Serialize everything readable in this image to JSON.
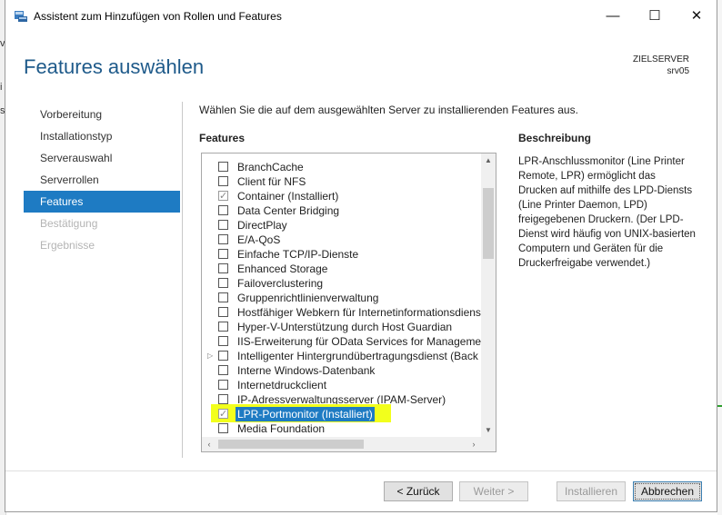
{
  "background_left": [
    "v",
    "i",
    "st"
  ],
  "window": {
    "title": "Assistent zum Hinzufügen von Rollen und Features",
    "minimize_glyph": "—",
    "maximize_glyph": "☐",
    "close_glyph": "✕"
  },
  "header": {
    "page_title": "Features auswählen",
    "target_label": "ZIELSERVER",
    "target_server": "srv05"
  },
  "nav": {
    "items": [
      {
        "label": "Vorbereitung",
        "state": "normal"
      },
      {
        "label": "Installationstyp",
        "state": "normal"
      },
      {
        "label": "Serverauswahl",
        "state": "normal"
      },
      {
        "label": "Serverrollen",
        "state": "normal"
      },
      {
        "label": "Features",
        "state": "active"
      },
      {
        "label": "Bestätigung",
        "state": "disabled"
      },
      {
        "label": "Ergebnisse",
        "state": "disabled"
      }
    ]
  },
  "main": {
    "instruction": "Wählen Sie die auf dem ausgewählten Server zu installierenden Features aus.",
    "features_label": "Features",
    "description_label": "Beschreibung",
    "description_text": "LPR-Anschlussmonitor (Line Printer Remote, LPR) ermöglicht das Drucken auf mithilfe des LPD-Diensts (Line Printer Daemon, LPD) freigegebenen Druckern. (Der LPD-Dienst wird häufig von UNIX-basierten Computern und Geräten für die Druckerfreigabe verwendet.)",
    "features": [
      {
        "label": "BranchCache",
        "checked": false,
        "expander": false,
        "highlight": false
      },
      {
        "label": "Client für NFS",
        "checked": false,
        "expander": false,
        "highlight": false
      },
      {
        "label": "Container (Installiert)",
        "checked": true,
        "expander": false,
        "highlight": false
      },
      {
        "label": "Data Center Bridging",
        "checked": false,
        "expander": false,
        "highlight": false
      },
      {
        "label": "DirectPlay",
        "checked": false,
        "expander": false,
        "highlight": false
      },
      {
        "label": "E/A-QoS",
        "checked": false,
        "expander": false,
        "highlight": false
      },
      {
        "label": "Einfache TCP/IP-Dienste",
        "checked": false,
        "expander": false,
        "highlight": false
      },
      {
        "label": "Enhanced Storage",
        "checked": false,
        "expander": false,
        "highlight": false
      },
      {
        "label": "Failoverclustering",
        "checked": false,
        "expander": false,
        "highlight": false
      },
      {
        "label": "Gruppenrichtlinienverwaltung",
        "checked": false,
        "expander": false,
        "highlight": false
      },
      {
        "label": "Hostfähiger Webkern für Internetinformationsdienste",
        "checked": false,
        "expander": false,
        "highlight": false
      },
      {
        "label": "Hyper-V-Unterstützung durch Host Guardian",
        "checked": false,
        "expander": false,
        "highlight": false
      },
      {
        "label": "IIS-Erweiterung für OData Services for Management",
        "checked": false,
        "expander": false,
        "highlight": false
      },
      {
        "label": "Intelligenter Hintergrundübertragungsdienst (Back",
        "checked": false,
        "expander": true,
        "highlight": false
      },
      {
        "label": "Interne Windows-Datenbank",
        "checked": false,
        "expander": false,
        "highlight": false
      },
      {
        "label": "Internetdruckclient",
        "checked": false,
        "expander": false,
        "highlight": false
      },
      {
        "label": "IP-Adressverwaltungsserver (IPAM-Server)",
        "checked": false,
        "expander": false,
        "highlight": false
      },
      {
        "label": "LPR-Portmonitor (Installiert)",
        "checked": true,
        "expander": false,
        "highlight": true
      },
      {
        "label": "Media Foundation",
        "checked": false,
        "expander": false,
        "highlight": false
      }
    ]
  },
  "footer": {
    "back_label": "< Zurück",
    "next_label": "Weiter >",
    "install_label": "Installieren",
    "cancel_label": "Abbrechen"
  },
  "colors": {
    "accent": "#1e7bc3",
    "title": "#1e5a8a",
    "marker": "#f2ff1c"
  }
}
